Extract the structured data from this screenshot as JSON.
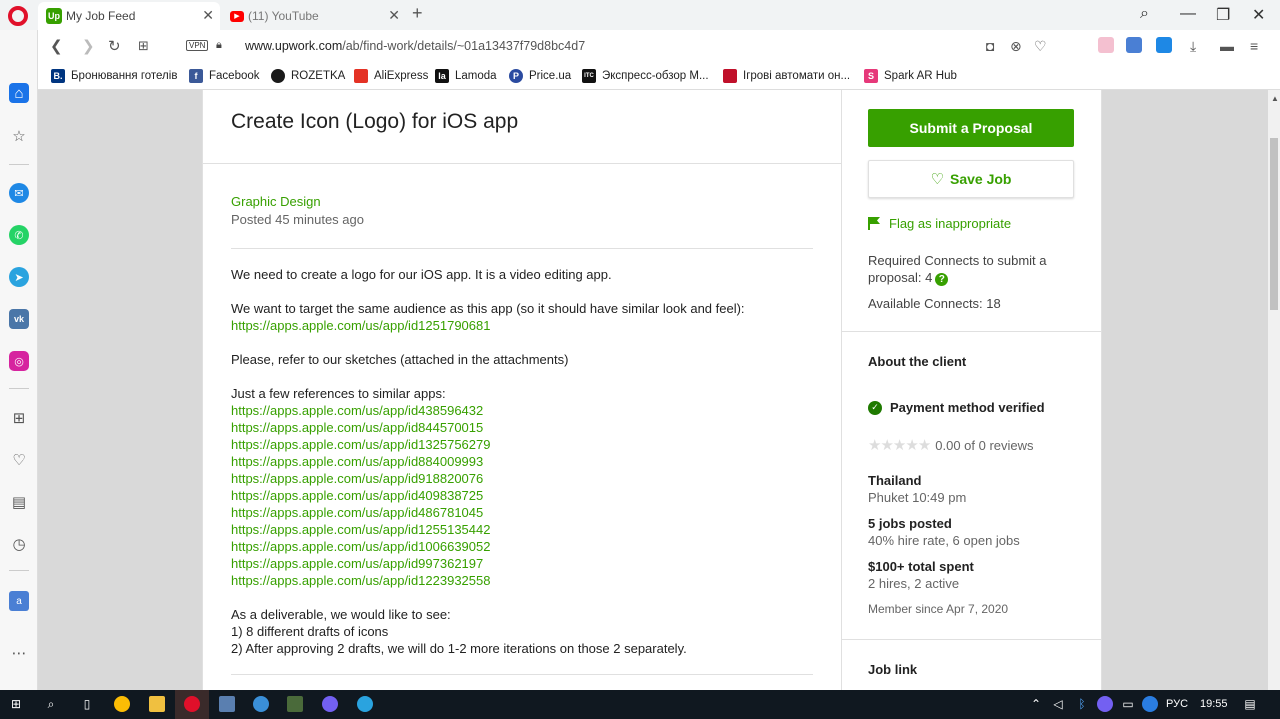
{
  "browser": {
    "tabs": [
      {
        "title": "My Job Feed",
        "favicon": "Up",
        "active": true
      },
      {
        "title": "(11) YouTube",
        "favicon": "yt",
        "active": false
      }
    ],
    "url_host": "www.upwork.com",
    "url_path": "/ab/find-work/details/~01a13437f79d8bc4d7",
    "vpn_label": "VPN",
    "bookmarks": [
      {
        "label": "Бронювання готелів",
        "icon": "B.",
        "color": "#003580"
      },
      {
        "label": "Facebook",
        "icon": "f",
        "color": "#3b5998"
      },
      {
        "label": "ROZETKA",
        "icon": "",
        "color": "#1a1a1a"
      },
      {
        "label": "AliExpress",
        "icon": "",
        "color": "#e43225"
      },
      {
        "label": "Lamoda",
        "icon": "la",
        "color": "#111111"
      },
      {
        "label": "Price.ua",
        "icon": "P",
        "color": "#2b4ba0"
      },
      {
        "label": "Экспресс-обзор М...",
        "icon": "ITC",
        "color": "#111111"
      },
      {
        "label": "Ігрові автомати он...",
        "icon": "",
        "color": "#c0102a"
      },
      {
        "label": "Spark AR Hub",
        "icon": "S",
        "color": "#e6397a"
      }
    ]
  },
  "job": {
    "title": "Create Icon (Logo) for iOS app",
    "category": "Graphic Design",
    "posted": "Posted 45 minutes ago",
    "description": {
      "p1": "We need to create a logo for our iOS app. It is a video editing app.",
      "p2": "We want to target the same audience as this app (so it should have similar look and feel):",
      "p2_link": "https://apps.apple.com/us/app/id1251790681",
      "p3": "Please, refer to our sketches (attached in the attachments)",
      "p4": "Just a few references to similar apps:",
      "links": [
        "https://apps.apple.com/us/app/id438596432",
        "https://apps.apple.com/us/app/id844570015",
        "https://apps.apple.com/us/app/id1325756279",
        "https://apps.apple.com/us/app/id884009993",
        "https://apps.apple.com/us/app/id918820076",
        "https://apps.apple.com/us/app/id409838725",
        "https://apps.apple.com/us/app/id486781045",
        "https://apps.apple.com/us/app/id1255135442",
        "https://apps.apple.com/us/app/id1006639052",
        "https://apps.apple.com/us/app/id997362197",
        "https://apps.apple.com/us/app/id1223932558"
      ],
      "p5": "As a deliverable, we would like to see:",
      "p5_line1": "1) 8 different drafts of icons",
      "p5_line2": "2) After approving 2 drafts, we will do 1-2 more iterations on those 2 separately."
    }
  },
  "sidebar": {
    "submit_label": "Submit a Proposal",
    "save_label": "Save Job",
    "flag_label": "Flag as inappropriate",
    "connects_required": "Required Connects to submit a proposal: 4",
    "connects_available": "Available Connects: 18",
    "about_title": "About the client",
    "payment_verified": "Payment method verified",
    "reviews": "0.00 of 0 reviews",
    "rating_stars": 0,
    "country": "Thailand",
    "local_time": "Phuket 10:49 pm",
    "jobs_posted": "5 jobs posted",
    "hire_rate": "40% hire rate, 6 open jobs",
    "total_spent": "$100+ total spent",
    "hires": "2 hires, 2 active",
    "member_since": "Member since Apr 7, 2020",
    "job_link_title": "Job link"
  },
  "taskbar": {
    "language": "РУС",
    "time": "19:55"
  },
  "colors": {
    "brand_green": "#37a000",
    "text_dark": "#222222",
    "text_muted": "#656565"
  }
}
